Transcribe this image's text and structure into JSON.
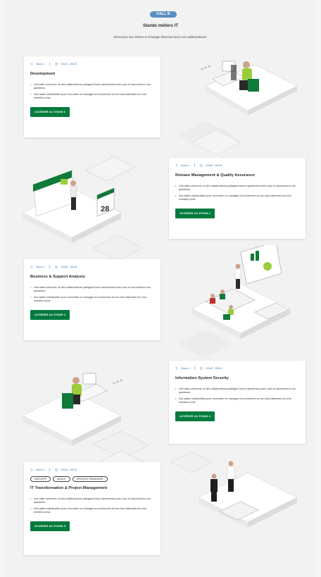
{
  "header": {
    "hall_badge": "HALL B",
    "title": "Stands métiers IT",
    "subtitle": "Découvrez nos métiers et échangez librement avec nos collaborateurs !"
  },
  "stands": [
    {
      "stand": "Stand 1",
      "time": "19h45 - 20h15",
      "title": "Development",
      "bullets": [
        "Une salle commune où des collaborateurs partagent leurs expériences avec vous et répondront à vos questions.",
        "Des salles individuelles pour rencontrer un manager à la recherche de son futur alternant lors d'un entretien privé."
      ],
      "button": "ACCÉDER AU STAND 1"
    },
    {
      "stand": "Stand 2",
      "time": "19h45 - 20h15",
      "title": "Release Management & Quality Assurance",
      "bullets": [
        "Une salle commune où des collaborateurs partagent leurs expériences avec vous et répondront à vos questions.",
        "Des salles individuelles pour rencontrer un manager à la recherche de son futur alternant lors d'un entretien privé."
      ],
      "button": "ACCÉDER AU STAND 2"
    },
    {
      "stand": "Stand 3",
      "time": "19h45 - 20h15",
      "title": "Business & Support Analysis",
      "bullets": [
        "Une salle commune où des collaborateurs partagent leurs expériences avec vous et répondront à vos questions.",
        "Des salles individuelles pour rencontrer un manager à la recherche de son futur alternant lors d'un entretien privé."
      ],
      "button": "ACCÉDER AU STAND 3"
    },
    {
      "stand": "Stand 4",
      "time": "19h45 - 20h15",
      "title": "Information System Security",
      "bullets": [
        "Une salle commune où des collaborateurs partagent leurs expériences avec vous et répondront à vos questions.",
        "Des salles individuelles pour rencontrer un manager à la recherche de son futur alternant lors d'un entretien privé."
      ],
      "button": "ACCÉDER AU STAND 4"
    },
    {
      "stand": "Stand 5",
      "time": "19h45 - 20h15",
      "tags": [
        "#DEVOPS",
        "#AGILE",
        "#PRODUCTMANAGER"
      ],
      "title": "IT Transformation & Project Management",
      "bullets": [
        "Une salle commune où des collaborateurs partagent leurs expériences avec vous et répondront à vos questions.",
        "Des salles individuelles pour rencontrer un manager à la recherche de son futur alternant lors d'un entretien privé."
      ],
      "button": "ACCÉDER AU STAND 5"
    }
  ],
  "calendar_day": "28",
  "colors": {
    "brand_green": "#007a3d",
    "accent_blue": "#3b7dbf",
    "badge_blue": "#5a8fc4"
  }
}
